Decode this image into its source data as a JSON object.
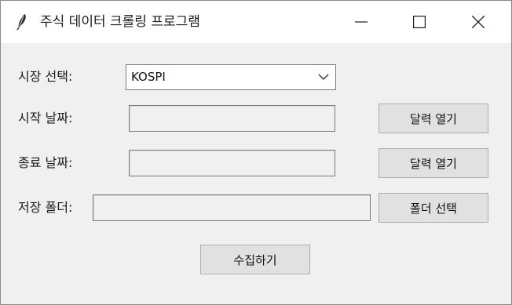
{
  "window": {
    "title": "주식 데이터 크롤링 프로그램",
    "icon": "feather-icon",
    "controls": [
      "minimize-icon",
      "maximize-icon",
      "close-icon"
    ]
  },
  "form": {
    "market_label": "시장 선택:",
    "market_value": "KOSPI",
    "start_date_label": "시작 날짜:",
    "start_date_value": "",
    "start_calendar_button": "달력 열기",
    "end_date_label": "종료 날짜:",
    "end_date_value": "",
    "end_calendar_button": "달력 열기",
    "folder_label": "저장 폴더:",
    "folder_value": "",
    "folder_button": "폴더 선택",
    "collect_button": "수집하기"
  }
}
